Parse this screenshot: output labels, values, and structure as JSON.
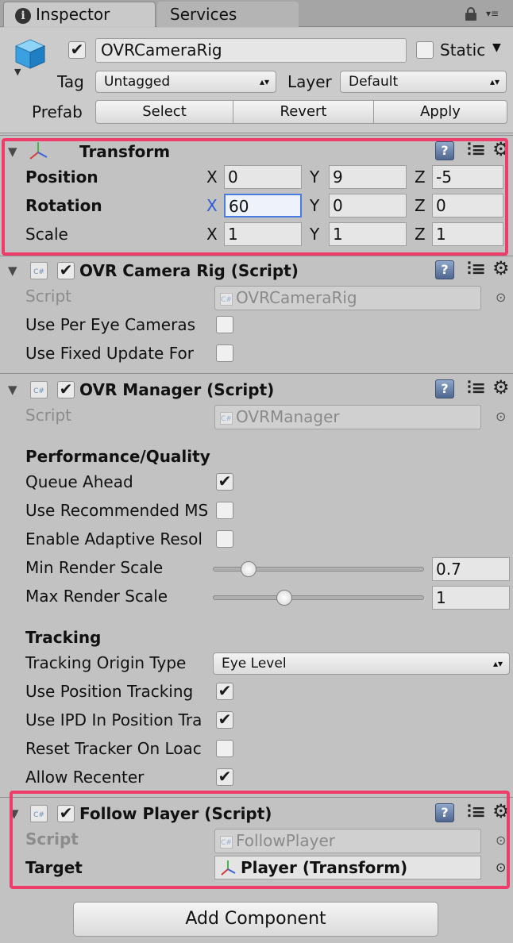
{
  "tabs": {
    "inspector": "Inspector",
    "services": "Services"
  },
  "header": {
    "name": "OVRCameraRig",
    "static_label": "Static",
    "tag_label": "Tag",
    "tag_value": "Untagged",
    "layer_label": "Layer",
    "layer_value": "Default",
    "prefab_label": "Prefab",
    "prefab_buttons": {
      "select": "Select",
      "revert": "Revert",
      "apply": "Apply"
    }
  },
  "transform": {
    "title": "Transform",
    "position": {
      "label": "Position",
      "x": "0",
      "y": "9",
      "z": "-5"
    },
    "rotation": {
      "label": "Rotation",
      "x": "60",
      "y": "0",
      "z": "0"
    },
    "scale": {
      "label": "Scale",
      "x": "1",
      "y": "1",
      "z": "1"
    },
    "axis": {
      "x": "X",
      "y": "Y",
      "z": "Z"
    }
  },
  "camera_rig": {
    "title": "OVR Camera Rig (Script)",
    "script_label": "Script",
    "script_value": "OVRCameraRig",
    "per_eye": "Use Per Eye Cameras",
    "fixed_update": "Use Fixed Update For"
  },
  "manager": {
    "title": "OVR Manager (Script)",
    "script_label": "Script",
    "script_value": "OVRManager",
    "perf_heading": "Performance/Quality",
    "queue_ahead": "Queue Ahead",
    "use_recommended": "Use Recommended MS",
    "adaptive": "Enable Adaptive Resol",
    "min_render": "Min Render Scale",
    "min_render_value": "0.7",
    "min_render_fraction": 0.17,
    "max_render": "Max Render Scale",
    "max_render_value": "1",
    "max_render_fraction": 0.34,
    "tracking_heading": "Tracking",
    "origin_type": "Tracking Origin Type",
    "origin_value": "Eye Level",
    "position_tracking": "Use Position Tracking",
    "ipd": "Use IPD In Position Tra",
    "reset_tracker": "Reset Tracker On Loac",
    "allow_recenter": "Allow Recenter"
  },
  "follow_player": {
    "title": "Follow Player (Script)",
    "script_label": "Script",
    "script_value": "FollowPlayer",
    "target_label": "Target",
    "target_value": "Player (Transform)"
  },
  "add_component": "Add Component",
  "icons": {
    "help": "?",
    "check": "✔",
    "cs": "C#"
  },
  "colors": {
    "highlight": "#ee3d6a",
    "axis_blue": "#2d5ad8"
  }
}
